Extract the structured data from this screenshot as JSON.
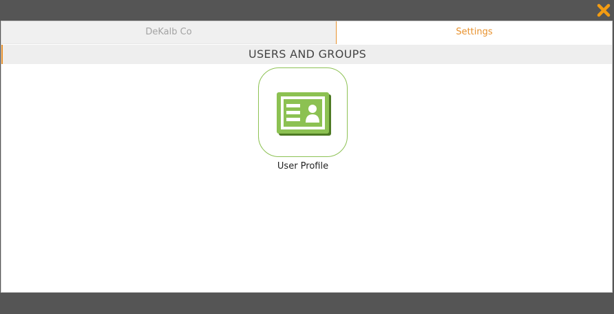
{
  "window": {
    "close_icon": "close-x-icon",
    "accent_color": "#e8912c"
  },
  "tabs": [
    {
      "label": "DeKalb Co",
      "active": false
    },
    {
      "label": "Settings",
      "active": true
    }
  ],
  "section": {
    "title": "USERS AND GROUPS"
  },
  "tiles": [
    {
      "label": "User Profile",
      "icon": "id-card-icon",
      "color": "#8cc152"
    }
  ]
}
